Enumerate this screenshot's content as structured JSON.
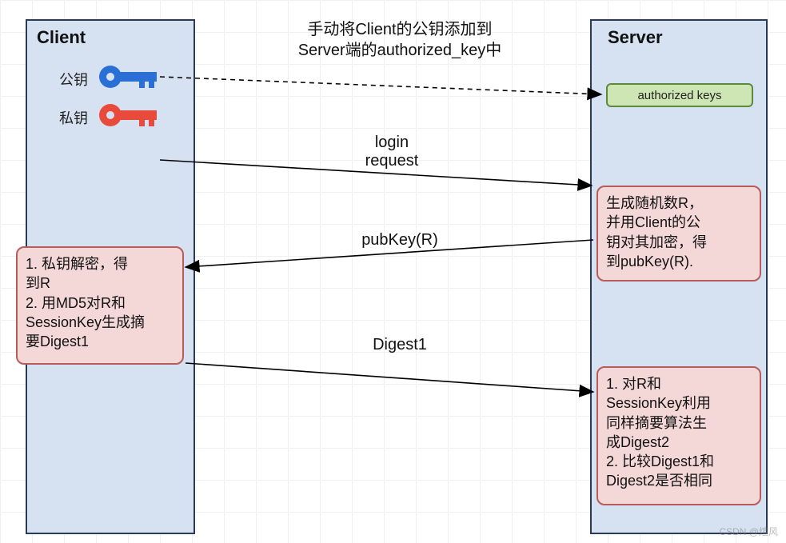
{
  "client": {
    "title": "Client",
    "public_key_label": "公钥",
    "private_key_label": "私钥"
  },
  "server": {
    "title": "Server",
    "authorized_keys_label": "authorized keys"
  },
  "caption": "手动将Client的公钥添加到\nServer端的authorized_key中",
  "messages": {
    "login": "login\nrequest",
    "pubkey": "pubKey(R)",
    "digest": "Digest1"
  },
  "notes": {
    "server_gen": "生成随机数R，\n并用Client的公\n钥对其加密，得\n到pubKey(R).",
    "client_dec": "1. 私钥解密，得\n到R\n2. 用MD5对R和\nSessionKey生成摘\n要Digest1",
    "server_cmp": "1. 对R和\nSessionKey利用\n同样摘要算法生\n成Digest2\n2. 比较Digest1和\nDigest2是否相同"
  },
  "colors": {
    "blue_key": "#2a6fd6",
    "red_key": "#e84b3c"
  },
  "watermark": "CSDN @煊风"
}
